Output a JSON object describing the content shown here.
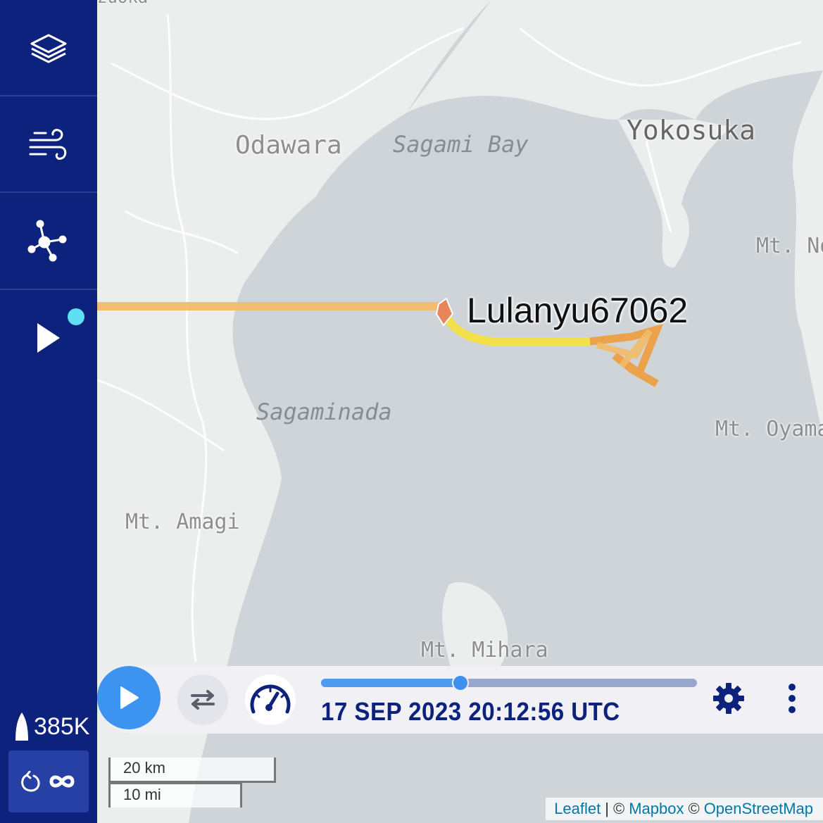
{
  "sidebar": {
    "vessel_count": "385K"
  },
  "map": {
    "labels": {
      "top_cut": "zuoka",
      "odawara": "Odawara",
      "sagami_bay": "Sagami Bay",
      "yokosuka": "Yokosuka",
      "mt_no": "Mt. No",
      "sagaminada": "Sagaminada",
      "mt_oyama": "Mt. Oyama",
      "mt_amagi": "Mt. Amagi",
      "mt_mihara": "Mt. Mihara"
    },
    "vessel": {
      "name": "Lulanyu67062"
    },
    "track_colors": {
      "path": "#f1bd68",
      "recent": "#f3e04a",
      "loiter": "#ee9b3c",
      "marker": "#e8855a"
    }
  },
  "playback": {
    "datetime": "17 SEP 2023 20:12:56 UTC",
    "progress": 0.37
  },
  "scale": {
    "km": "20 km",
    "mi": "10 mi"
  },
  "attribution": {
    "leaflet": "Leaflet",
    "sep": "|",
    "copy1": "©",
    "mapbox": "Mapbox",
    "copy2": "©",
    "osm": "OpenStreetMap"
  }
}
